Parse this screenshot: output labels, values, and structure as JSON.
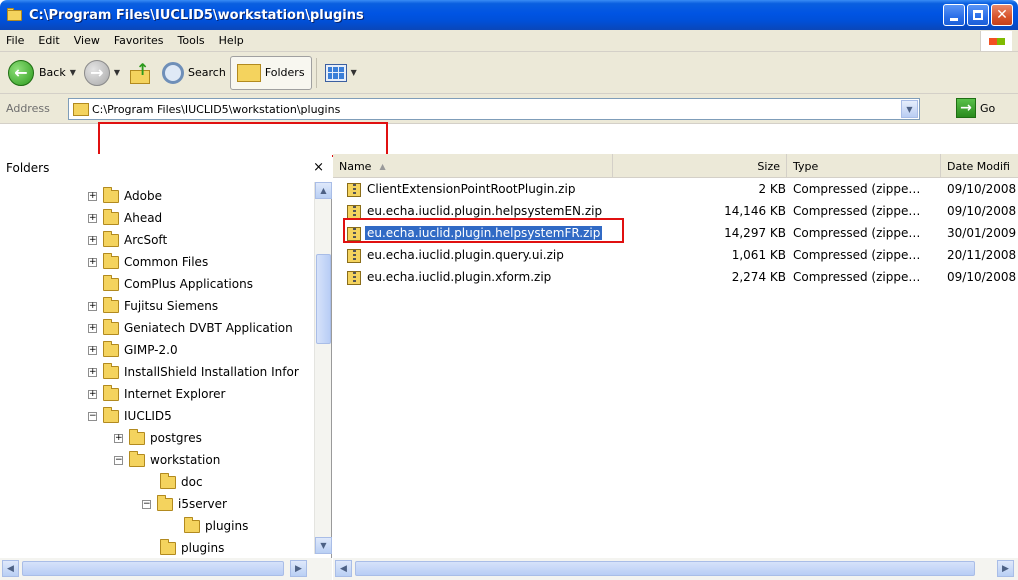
{
  "window": {
    "title": "C:\\Program Files\\IUCLID5\\workstation\\plugins"
  },
  "menu": [
    "File",
    "Edit",
    "View",
    "Favorites",
    "Tools",
    "Help"
  ],
  "toolbar": {
    "back": "Back",
    "search": "Search",
    "folders": "Folders"
  },
  "address": {
    "label": "Address",
    "path": "C:\\Program Files\\IUCLID5\\workstation\\plugins",
    "go": "Go"
  },
  "folders_pane": {
    "title": "Folders",
    "close": "×",
    "tree": [
      {
        "label": "Adobe",
        "expander": "+"
      },
      {
        "label": "Ahead",
        "expander": "+"
      },
      {
        "label": "ArcSoft",
        "expander": "+"
      },
      {
        "label": "Common Files",
        "expander": "+"
      },
      {
        "label": "ComPlus Applications",
        "expander": ""
      },
      {
        "label": "Fujitsu Siemens",
        "expander": "+"
      },
      {
        "label": "Geniatech DVBT Application",
        "expander": "+"
      },
      {
        "label": "GIMP-2.0",
        "expander": "+"
      },
      {
        "label": "InstallShield Installation Infor",
        "expander": "+"
      },
      {
        "label": "Internet Explorer",
        "expander": "+"
      },
      {
        "label": "IUCLID5",
        "expander": "−"
      },
      {
        "label": "postgres",
        "expander": "+"
      },
      {
        "label": "workstation",
        "expander": "−"
      },
      {
        "label": "doc",
        "expander": ""
      },
      {
        "label": "i5server",
        "expander": "−"
      },
      {
        "label": "plugins",
        "expander": ""
      },
      {
        "label": "plugins",
        "expander": ""
      }
    ]
  },
  "columns": {
    "name": "Name",
    "size": "Size",
    "type": "Type",
    "date": "Date Modifi"
  },
  "files": [
    {
      "name": "ClientExtensionPointRootPlugin.zip",
      "size": "2 KB",
      "type": "Compressed (zippe…",
      "date": "09/10/2008"
    },
    {
      "name": "eu.echa.iuclid.plugin.helpsystemEN.zip",
      "size": "14,146 KB",
      "type": "Compressed (zippe…",
      "date": "09/10/2008"
    },
    {
      "name": "eu.echa.iuclid.plugin.helpsystemFR.zip",
      "size": "14,297 KB",
      "type": "Compressed (zippe…",
      "date": "30/01/2009"
    },
    {
      "name": "eu.echa.iuclid.plugin.query.ui.zip",
      "size": "1,061 KB",
      "type": "Compressed (zippe…",
      "date": "20/11/2008"
    },
    {
      "name": "eu.echa.iuclid.plugin.xform.zip",
      "size": "2,274 KB",
      "type": "Compressed (zippe…",
      "date": "09/10/2008"
    }
  ],
  "colors": {
    "titlebar": "#0054e3",
    "selection": "#316ac5",
    "highlight_box": "#e01010"
  }
}
